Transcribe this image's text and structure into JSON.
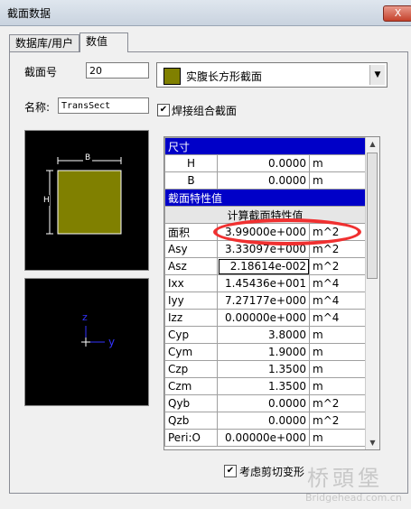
{
  "window": {
    "title": "截面数据",
    "close_label": "X"
  },
  "tabs": [
    {
      "label": "数据库/用户"
    },
    {
      "label": "数值"
    }
  ],
  "section_no": {
    "label": "截面号",
    "value": "20"
  },
  "section_type": {
    "label": "实腹长方形截面",
    "swatch_color": "#808000"
  },
  "name": {
    "label": "名称:",
    "value": "TransSect"
  },
  "welded": {
    "label": "焊接组合截面",
    "checked": true
  },
  "preview": {
    "dim_b": "B",
    "dim_h": "H",
    "shape_color": "#808000"
  },
  "axes_preview": {
    "z": "z",
    "y": "y"
  },
  "grid": {
    "dim_header": "尺寸",
    "dims": [
      {
        "name": "H",
        "value": "0.0000",
        "unit": "m"
      },
      {
        "name": "B",
        "value": "0.0000",
        "unit": "m"
      }
    ],
    "prop_header": "截面特性值",
    "calc_button": "计算截面特性值",
    "props": [
      {
        "name": "面积",
        "value": "3.99000e+000",
        "unit": "m^2"
      },
      {
        "name": "Asy",
        "value": "3.33097e+000",
        "unit": "m^2"
      },
      {
        "name": "Asz",
        "value": "2.18614e-002",
        "unit": "m^2"
      },
      {
        "name": "Ixx",
        "value": "1.45436e+001",
        "unit": "m^4"
      },
      {
        "name": "Iyy",
        "value": "7.27177e+000",
        "unit": "m^4"
      },
      {
        "name": "Izz",
        "value": "0.00000e+000",
        "unit": "m^4"
      },
      {
        "name": "Cyp",
        "value": "3.8000",
        "unit": "m"
      },
      {
        "name": "Cym",
        "value": "1.9000",
        "unit": "m"
      },
      {
        "name": "Czp",
        "value": "1.3500",
        "unit": "m"
      },
      {
        "name": "Czm",
        "value": "1.3500",
        "unit": "m"
      },
      {
        "name": "Qyb",
        "value": "0.0000",
        "unit": "m^2"
      },
      {
        "name": "Qzb",
        "value": "0.0000",
        "unit": "m^2"
      },
      {
        "name": "Peri:O",
        "value": "0.00000e+000",
        "unit": "m"
      }
    ]
  },
  "shear_deform": {
    "label": "考虑剪切变形",
    "checked": true
  },
  "watermark": {
    "main": "桥頭堡",
    "sub": "Bridgehead.com.cn"
  }
}
